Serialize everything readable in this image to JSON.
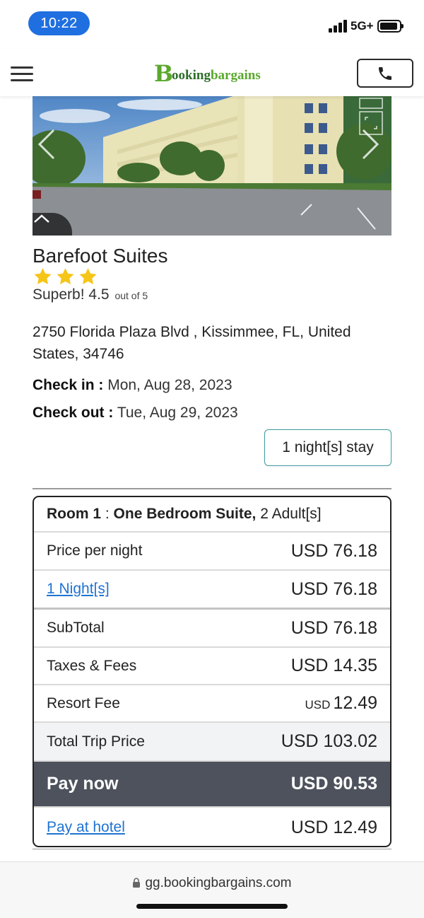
{
  "status_bar": {
    "time": "10:22",
    "network": "5G+"
  },
  "header": {
    "logo_initial": "B",
    "logo_part1": "ooking",
    "logo_part2": "bargains",
    "menu_icon": "hamburger-icon",
    "phone_icon": "phone-icon"
  },
  "hotel": {
    "name": "Barefoot Suites",
    "star_count": 3,
    "rating_label": "Superb! 4.5",
    "rating_suffix": "out of 5",
    "address": "2750 Florida Plaza Blvd , Kissimmee, FL, United States, 34746",
    "check_in_label": "Check in :",
    "check_in": "Mon, Aug 28, 2023",
    "check_out_label": "Check out :",
    "check_out": "Tue, Aug 29, 2023",
    "nights_button": "1 night[s] stay"
  },
  "price": {
    "room_prefix": "Room 1",
    "room_sep": " : ",
    "room_type": "One Bedroom Suite,",
    "room_guests": " 2 Adult[s]",
    "rows": [
      {
        "label": "Price per night",
        "value": "USD 76.18"
      },
      {
        "label": "1 Night[s]",
        "value": "USD 76.18"
      },
      {
        "label": "SubTotal",
        "value": "USD 76.18"
      },
      {
        "label": "Taxes & Fees",
        "value": "USD 14.35"
      },
      {
        "label": "Resort Fee",
        "currency": "USD",
        "amount": "12.49"
      },
      {
        "label": "Total Trip Price",
        "value": "USD 103.02"
      },
      {
        "label": "Pay now",
        "value": "USD 90.53"
      },
      {
        "label": "Pay at hotel",
        "value": "USD 12.49"
      }
    ]
  },
  "browser": {
    "url": "gg.bookingbargains.com"
  },
  "colors": {
    "time_pill": "#1f6fe0",
    "logo_green": "#5aa82d",
    "logo_dark_green": "#2d6e2a",
    "link_blue": "#1f73d1",
    "pay_now_bg": "#4d525d",
    "nights_border": "#3a9a9d",
    "star_yellow": "#f5c518"
  }
}
